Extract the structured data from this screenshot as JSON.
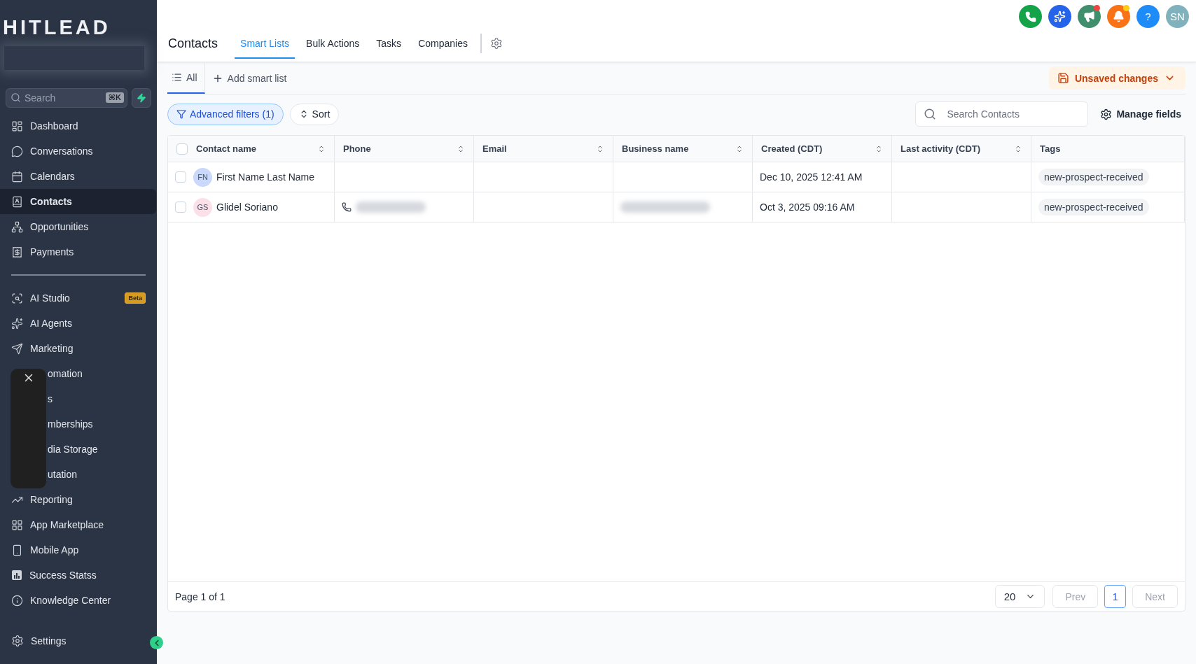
{
  "sidebar": {
    "logo": "HITLEAD",
    "search": {
      "placeholder": "Search",
      "shortcut": "⌘K"
    },
    "main_items": [
      {
        "label": "Dashboard",
        "selected": false
      },
      {
        "label": "Conversations",
        "selected": false
      },
      {
        "label": "Calendars",
        "selected": false
      },
      {
        "label": "Contacts",
        "selected": true
      },
      {
        "label": "Opportunities",
        "selected": false
      },
      {
        "label": "Payments",
        "selected": false
      }
    ],
    "more_items": [
      {
        "label": "AI Studio",
        "kind": "link",
        "selected": false,
        "badge": "Beta"
      },
      {
        "label": "AI Agents",
        "kind": "link",
        "selected": false
      },
      {
        "label": "Marketing",
        "kind": "link",
        "selected": false
      },
      {
        "label": "omation",
        "kind": "partly_hidden",
        "selected": false
      },
      {
        "label": "s",
        "kind": "partly_hidden",
        "selected": false
      },
      {
        "label": "mberships",
        "kind": "partly_hidden",
        "selected": false
      },
      {
        "label": "dia Storage",
        "kind": "partly_hidden",
        "selected": false
      },
      {
        "label": "utation",
        "kind": "partly_hidden",
        "selected": false
      },
      {
        "label": "Reporting",
        "kind": "link",
        "selected": false
      },
      {
        "label": "App Marketplace",
        "kind": "link",
        "selected": false
      },
      {
        "label": "Mobile App",
        "kind": "link",
        "selected": false
      },
      {
        "label": "Success Statss",
        "kind": "link",
        "selected": false
      },
      {
        "label": "Knowledge Center",
        "kind": "link",
        "selected": false
      }
    ],
    "settings": "Settings"
  },
  "top_actions": [
    {
      "kind": "phone",
      "color": "#15a34a",
      "dot": false
    },
    {
      "kind": "sparkle",
      "color": "#2563eb",
      "dot": false
    },
    {
      "kind": "megaphone",
      "color": "#3f8e6c",
      "dot": true
    },
    {
      "kind": "bell",
      "color": "#f97316",
      "dot": true
    },
    {
      "kind": "help",
      "color": "#1d8cf8",
      "dot": false,
      "text": "?"
    },
    {
      "kind": "avatar",
      "color": "#7fb2bc",
      "dot": false,
      "text": "SN"
    }
  ],
  "page_title": "Contacts",
  "tabs": [
    {
      "label": "Smart Lists",
      "selected": true
    },
    {
      "label": "Bulk Actions",
      "selected": false
    },
    {
      "label": "Tasks",
      "selected": false
    },
    {
      "label": "Companies",
      "selected": false
    }
  ],
  "lists": [
    {
      "label": "All",
      "selected": true
    }
  ],
  "add_list": "Add smart list",
  "unsaved": "Unsaved changes",
  "filters": [
    {
      "label": "Advanced filters (1)",
      "active": true
    },
    {
      "label": "Sort",
      "active": false
    }
  ],
  "search": {
    "placeholder": "Search Contacts"
  },
  "manage_fields": "Manage fields",
  "table": {
    "select_all_checked": false,
    "columns": [
      {
        "label": "Contact name",
        "sortable": true
      },
      {
        "label": "Phone",
        "sortable": true
      },
      {
        "label": "Email",
        "sortable": true
      },
      {
        "label": "Business name",
        "sortable": true
      },
      {
        "label": "Created (CDT)",
        "sortable": true
      },
      {
        "label": "Last activity (CDT)",
        "sortable": true
      },
      {
        "label": "Tags",
        "sortable": false
      }
    ],
    "rows": [
      {
        "checked": false,
        "initials": "FN",
        "color": "#c9d8fb",
        "name": "First Name Last Name",
        "phone_blurred": false,
        "business_blurred": false,
        "created": "Dec 10, 2025 12:41 AM",
        "tag": "new-prospect-received"
      },
      {
        "checked": false,
        "initials": "GS",
        "color": "#fbe0ea",
        "name": "Glidel Soriano",
        "phone_blurred": true,
        "business_blurred": true,
        "created": "Oct 3, 2025 09:16 AM",
        "tag": "new-prospect-received"
      }
    ]
  },
  "pagination": {
    "summary": "Page 1 of 1",
    "page_size": "20",
    "prev": {
      "label": "Prev",
      "disabled": true
    },
    "pages": [
      {
        "label": "1",
        "selected": true
      }
    ],
    "next": {
      "label": "Next",
      "disabled": true
    }
  }
}
